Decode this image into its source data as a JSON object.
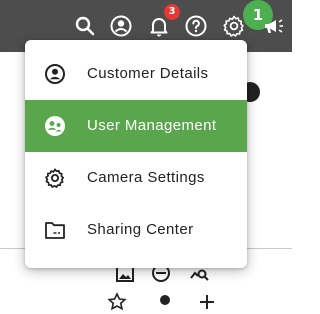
{
  "colors": {
    "topbar_bg": "#4d4d4d",
    "accent_green": "#5aa64c",
    "notification_badge": "#e53935"
  },
  "topbar": {
    "icons": [
      "search-icon",
      "account-circle-icon",
      "bell-icon",
      "help-icon",
      "gear-icon",
      "megaphone-icon"
    ],
    "notification_count": "3",
    "status_badge": "1"
  },
  "menu": {
    "items": [
      {
        "label": "Customer Details",
        "icon": "account-circle-icon",
        "active": false
      },
      {
        "label": "User Management",
        "icon": "user-management-icon",
        "active": true
      },
      {
        "label": "Camera Settings",
        "icon": "gear-icon",
        "active": false
      },
      {
        "label": "Sharing Center",
        "icon": "folder-icon",
        "active": false
      }
    ]
  }
}
